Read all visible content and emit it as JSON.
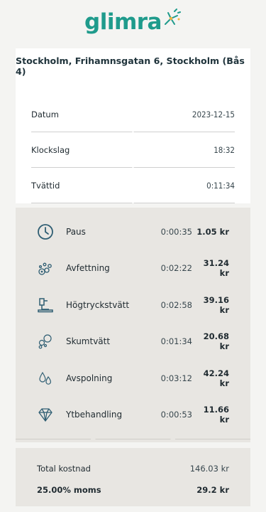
{
  "brand": {
    "name": "glimra",
    "color": "#1f9b8c"
  },
  "location": "Stockholm, Frihamnsgatan 6, Stockholm (Bås 4)",
  "info": [
    {
      "label": "Datum",
      "value": "2023-12-15"
    },
    {
      "label": "Klockslag",
      "value": "18:32"
    },
    {
      "label": "Tvättid",
      "value": "0:11:34"
    }
  ],
  "services": [
    {
      "icon": "clock-icon",
      "name": "Paus",
      "time": "0:00:35",
      "cost": "1.05 kr"
    },
    {
      "icon": "degrease-icon",
      "name": "Avfettning",
      "time": "0:02:22",
      "cost": "31.24 kr"
    },
    {
      "icon": "pressure-washer-icon",
      "name": "Högtryckstvätt",
      "time": "0:02:58",
      "cost": "39.16 kr"
    },
    {
      "icon": "foam-icon",
      "name": "Skumtvätt",
      "time": "0:01:34",
      "cost": "20.68 kr"
    },
    {
      "icon": "rinse-drops-icon",
      "name": "Avspolning",
      "time": "0:03:12",
      "cost": "42.24 kr"
    },
    {
      "icon": "diamond-icon",
      "name": "Ytbehandling",
      "time": "0:00:53",
      "cost": "11.66 kr"
    }
  ],
  "totals": {
    "total_label": "Total kostnad",
    "total_value": "146.03 kr",
    "vat_label": "25.00% moms",
    "vat_value": "29.2 kr"
  }
}
